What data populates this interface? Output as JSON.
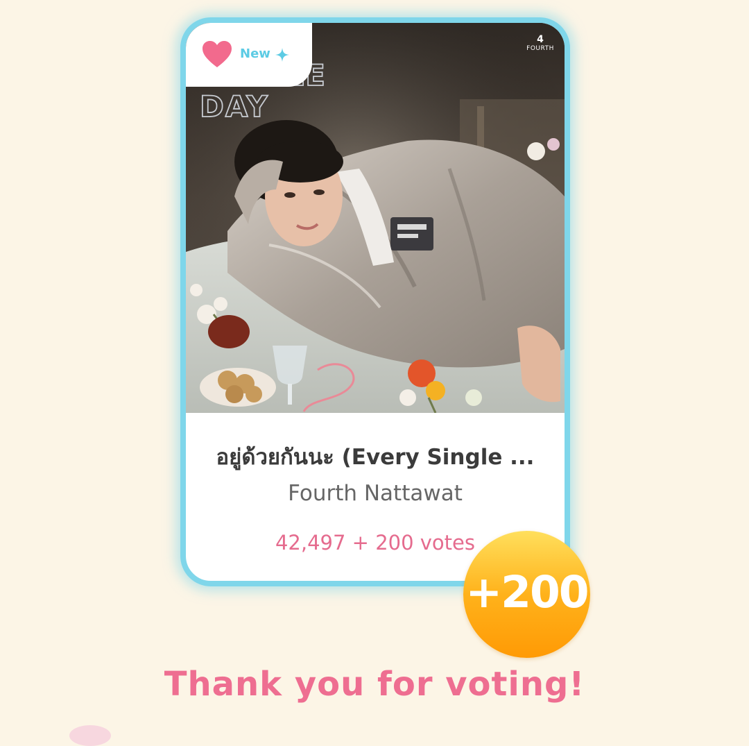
{
  "card": {
    "badge_label": "New",
    "image_headline": "SINGLE\nDAY",
    "brand_mark": "4",
    "brand_name": "FOURTH",
    "song_title": "อยู่ด้วยกันนะ (Every Single ...",
    "artist": "Fourth Nattawat",
    "votes": "42,497 + 200 votes"
  },
  "reward_badge": {
    "text": "+200"
  },
  "message": "Thank you for voting!",
  "icons": {
    "heart": "heart-icon",
    "sparkle": "sparkle-icon"
  },
  "colors": {
    "background": "#fcf5e6",
    "card_border": "#7fd6ea",
    "accent_pink": "#ee6e91",
    "badge_orange": "#ff9a05",
    "new_label": "#5ccbe4"
  }
}
